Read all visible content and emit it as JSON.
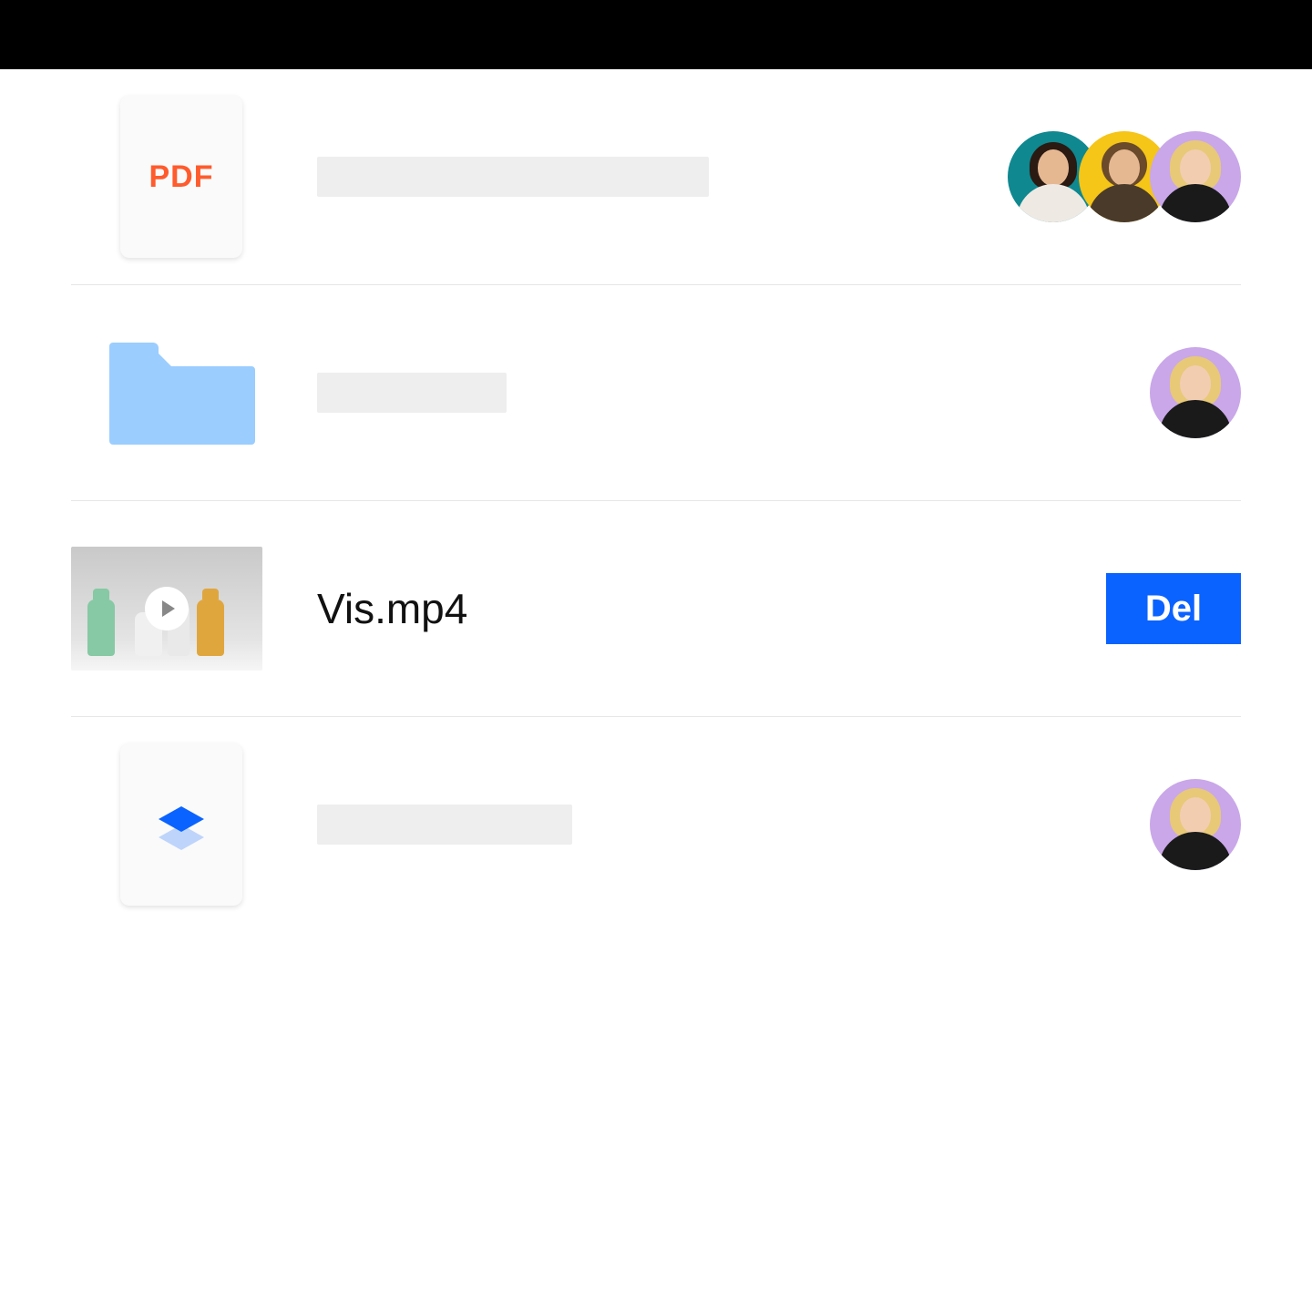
{
  "colors": {
    "accent": "#0b63ff",
    "pdf_red": "#ff5b2d",
    "folder_blue": "#9bcdff",
    "avatar_teal": "#0f8890",
    "avatar_yellow": "#f5c518",
    "avatar_lilac": "#c9a7e8"
  },
  "rows": [
    {
      "type": "pdf",
      "icon_label": "PDF",
      "name": "",
      "name_placeholder_width": "lg",
      "collaborators": [
        {
          "bg": "teal",
          "hair": "dark",
          "body": "light"
        },
        {
          "bg": "yellow",
          "hair": "brown",
          "body": "pattern"
        },
        {
          "bg": "lilac",
          "hair": "blonde",
          "body": "dark"
        }
      ],
      "action": null
    },
    {
      "type": "folder",
      "name": "",
      "name_placeholder_width": "sm",
      "collaborators": [
        {
          "bg": "lilac",
          "hair": "blonde",
          "body": "dark"
        }
      ],
      "action": null
    },
    {
      "type": "video",
      "name": "Vis.mp4",
      "name_placeholder_width": null,
      "collaborators": [],
      "action": {
        "label": "Del"
      }
    },
    {
      "type": "paper",
      "icon": "dropbox-paper",
      "name": "",
      "name_placeholder_width": "md",
      "collaborators": [
        {
          "bg": "lilac",
          "hair": "blonde",
          "body": "dark"
        }
      ],
      "action": null
    }
  ]
}
